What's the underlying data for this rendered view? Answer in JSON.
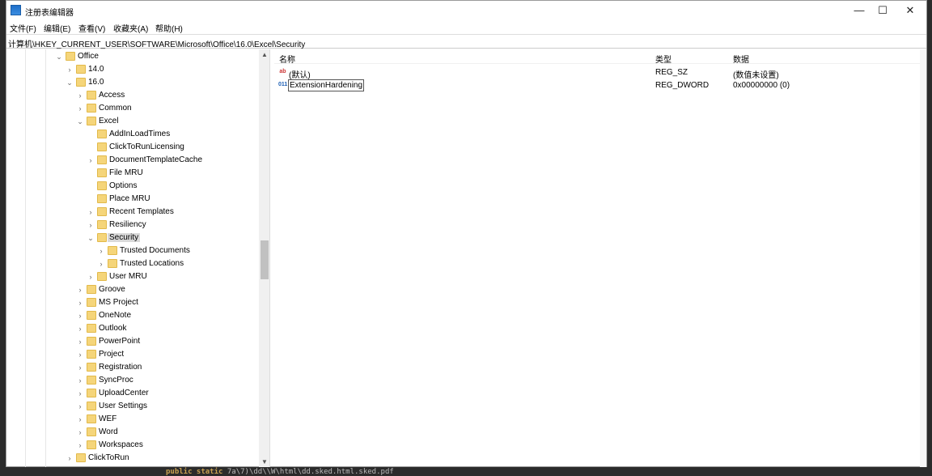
{
  "window": {
    "title": "注册表编辑器",
    "controls": {
      "minimize": "—",
      "maximize": "☐",
      "close": "✕"
    }
  },
  "menu": [
    "文件(F)",
    "编辑(E)",
    "查看(V)",
    "收藏夹(A)",
    "帮助(H)"
  ],
  "address": "计算机\\HKEY_CURRENT_USER\\SOFTWARE\\Microsoft\\Office\\16.0\\Excel\\Security",
  "tree": [
    {
      "label": "Office",
      "level": 0,
      "state": "expanded"
    },
    {
      "label": "14.0",
      "level": 1,
      "state": "collapsed"
    },
    {
      "label": "16.0",
      "level": 1,
      "state": "expanded"
    },
    {
      "label": "Access",
      "level": 2,
      "state": "collapsed"
    },
    {
      "label": "Common",
      "level": 2,
      "state": "collapsed"
    },
    {
      "label": "Excel",
      "level": 2,
      "state": "expanded"
    },
    {
      "label": "AddInLoadTimes",
      "level": 3,
      "state": "leaf"
    },
    {
      "label": "ClickToRunLicensing",
      "level": 3,
      "state": "leaf"
    },
    {
      "label": "DocumentTemplateCache",
      "level": 3,
      "state": "collapsed"
    },
    {
      "label": "File MRU",
      "level": 3,
      "state": "leaf"
    },
    {
      "label": "Options",
      "level": 3,
      "state": "leaf"
    },
    {
      "label": "Place MRU",
      "level": 3,
      "state": "leaf"
    },
    {
      "label": "Recent Templates",
      "level": 3,
      "state": "collapsed"
    },
    {
      "label": "Resiliency",
      "level": 3,
      "state": "collapsed"
    },
    {
      "label": "Security",
      "level": 3,
      "state": "expanded",
      "selected": true
    },
    {
      "label": "Trusted Documents",
      "level": 4,
      "state": "collapsed"
    },
    {
      "label": "Trusted Locations",
      "level": 4,
      "state": "collapsed"
    },
    {
      "label": "User MRU",
      "level": 3,
      "state": "collapsed"
    },
    {
      "label": "Groove",
      "level": 2,
      "state": "collapsed"
    },
    {
      "label": "MS Project",
      "level": 2,
      "state": "collapsed"
    },
    {
      "label": "OneNote",
      "level": 2,
      "state": "collapsed"
    },
    {
      "label": "Outlook",
      "level": 2,
      "state": "collapsed"
    },
    {
      "label": "PowerPoint",
      "level": 2,
      "state": "collapsed"
    },
    {
      "label": "Project",
      "level": 2,
      "state": "collapsed"
    },
    {
      "label": "Registration",
      "level": 2,
      "state": "collapsed"
    },
    {
      "label": "SyncProc",
      "level": 2,
      "state": "collapsed"
    },
    {
      "label": "UploadCenter",
      "level": 2,
      "state": "collapsed"
    },
    {
      "label": "User Settings",
      "level": 2,
      "state": "collapsed"
    },
    {
      "label": "WEF",
      "level": 2,
      "state": "collapsed"
    },
    {
      "label": "Word",
      "level": 2,
      "state": "collapsed"
    },
    {
      "label": "Workspaces",
      "level": 2,
      "state": "collapsed"
    },
    {
      "label": "ClickToRun",
      "level": 1,
      "state": "collapsed"
    }
  ],
  "list": {
    "headers": {
      "name": "名称",
      "type": "类型",
      "data": "数据"
    },
    "rows": [
      {
        "icon": "string-value-icon",
        "name": "(默认)",
        "type": "REG_SZ",
        "data": "(数值未设置)"
      },
      {
        "icon": "dword-value-icon",
        "name": "ExtensionHardening",
        "type": "REG_DWORD",
        "data": "0x00000000 (0)",
        "editing": true
      }
    ]
  },
  "background": {
    "code": "public static",
    "code_rest": "7a\\7)\\dd\\\\W\\html\\dd.sked.html.sked.pdf"
  }
}
